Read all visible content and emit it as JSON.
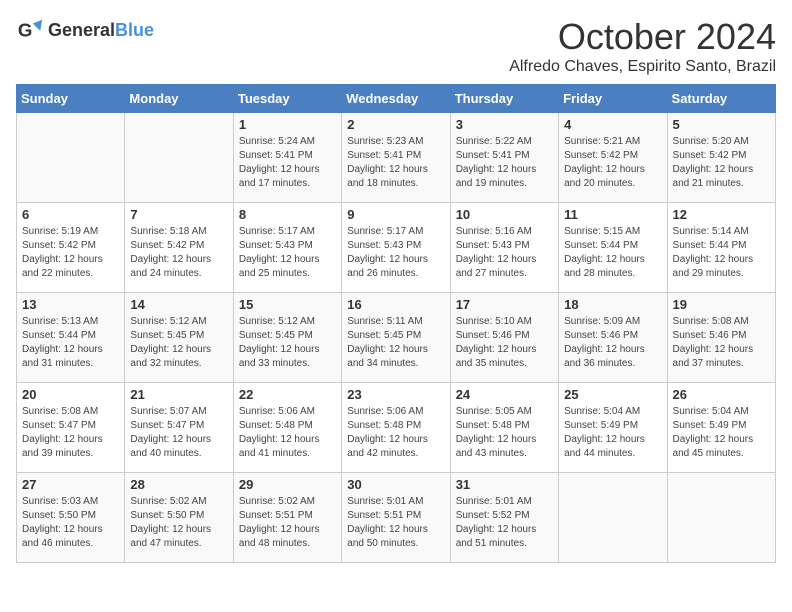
{
  "logo": {
    "general": "General",
    "blue": "Blue"
  },
  "header": {
    "month": "October 2024",
    "location": "Alfredo Chaves, Espirito Santo, Brazil"
  },
  "days_of_week": [
    "Sunday",
    "Monday",
    "Tuesday",
    "Wednesday",
    "Thursday",
    "Friday",
    "Saturday"
  ],
  "weeks": [
    [
      {
        "day": "",
        "content": ""
      },
      {
        "day": "",
        "content": ""
      },
      {
        "day": "1",
        "content": "Sunrise: 5:24 AM\nSunset: 5:41 PM\nDaylight: 12 hours and 17 minutes."
      },
      {
        "day": "2",
        "content": "Sunrise: 5:23 AM\nSunset: 5:41 PM\nDaylight: 12 hours and 18 minutes."
      },
      {
        "day": "3",
        "content": "Sunrise: 5:22 AM\nSunset: 5:41 PM\nDaylight: 12 hours and 19 minutes."
      },
      {
        "day": "4",
        "content": "Sunrise: 5:21 AM\nSunset: 5:42 PM\nDaylight: 12 hours and 20 minutes."
      },
      {
        "day": "5",
        "content": "Sunrise: 5:20 AM\nSunset: 5:42 PM\nDaylight: 12 hours and 21 minutes."
      }
    ],
    [
      {
        "day": "6",
        "content": "Sunrise: 5:19 AM\nSunset: 5:42 PM\nDaylight: 12 hours and 22 minutes."
      },
      {
        "day": "7",
        "content": "Sunrise: 5:18 AM\nSunset: 5:42 PM\nDaylight: 12 hours and 24 minutes."
      },
      {
        "day": "8",
        "content": "Sunrise: 5:17 AM\nSunset: 5:43 PM\nDaylight: 12 hours and 25 minutes."
      },
      {
        "day": "9",
        "content": "Sunrise: 5:17 AM\nSunset: 5:43 PM\nDaylight: 12 hours and 26 minutes."
      },
      {
        "day": "10",
        "content": "Sunrise: 5:16 AM\nSunset: 5:43 PM\nDaylight: 12 hours and 27 minutes."
      },
      {
        "day": "11",
        "content": "Sunrise: 5:15 AM\nSunset: 5:44 PM\nDaylight: 12 hours and 28 minutes."
      },
      {
        "day": "12",
        "content": "Sunrise: 5:14 AM\nSunset: 5:44 PM\nDaylight: 12 hours and 29 minutes."
      }
    ],
    [
      {
        "day": "13",
        "content": "Sunrise: 5:13 AM\nSunset: 5:44 PM\nDaylight: 12 hours and 31 minutes."
      },
      {
        "day": "14",
        "content": "Sunrise: 5:12 AM\nSunset: 5:45 PM\nDaylight: 12 hours and 32 minutes."
      },
      {
        "day": "15",
        "content": "Sunrise: 5:12 AM\nSunset: 5:45 PM\nDaylight: 12 hours and 33 minutes."
      },
      {
        "day": "16",
        "content": "Sunrise: 5:11 AM\nSunset: 5:45 PM\nDaylight: 12 hours and 34 minutes."
      },
      {
        "day": "17",
        "content": "Sunrise: 5:10 AM\nSunset: 5:46 PM\nDaylight: 12 hours and 35 minutes."
      },
      {
        "day": "18",
        "content": "Sunrise: 5:09 AM\nSunset: 5:46 PM\nDaylight: 12 hours and 36 minutes."
      },
      {
        "day": "19",
        "content": "Sunrise: 5:08 AM\nSunset: 5:46 PM\nDaylight: 12 hours and 37 minutes."
      }
    ],
    [
      {
        "day": "20",
        "content": "Sunrise: 5:08 AM\nSunset: 5:47 PM\nDaylight: 12 hours and 39 minutes."
      },
      {
        "day": "21",
        "content": "Sunrise: 5:07 AM\nSunset: 5:47 PM\nDaylight: 12 hours and 40 minutes."
      },
      {
        "day": "22",
        "content": "Sunrise: 5:06 AM\nSunset: 5:48 PM\nDaylight: 12 hours and 41 minutes."
      },
      {
        "day": "23",
        "content": "Sunrise: 5:06 AM\nSunset: 5:48 PM\nDaylight: 12 hours and 42 minutes."
      },
      {
        "day": "24",
        "content": "Sunrise: 5:05 AM\nSunset: 5:48 PM\nDaylight: 12 hours and 43 minutes."
      },
      {
        "day": "25",
        "content": "Sunrise: 5:04 AM\nSunset: 5:49 PM\nDaylight: 12 hours and 44 minutes."
      },
      {
        "day": "26",
        "content": "Sunrise: 5:04 AM\nSunset: 5:49 PM\nDaylight: 12 hours and 45 minutes."
      }
    ],
    [
      {
        "day": "27",
        "content": "Sunrise: 5:03 AM\nSunset: 5:50 PM\nDaylight: 12 hours and 46 minutes."
      },
      {
        "day": "28",
        "content": "Sunrise: 5:02 AM\nSunset: 5:50 PM\nDaylight: 12 hours and 47 minutes."
      },
      {
        "day": "29",
        "content": "Sunrise: 5:02 AM\nSunset: 5:51 PM\nDaylight: 12 hours and 48 minutes."
      },
      {
        "day": "30",
        "content": "Sunrise: 5:01 AM\nSunset: 5:51 PM\nDaylight: 12 hours and 50 minutes."
      },
      {
        "day": "31",
        "content": "Sunrise: 5:01 AM\nSunset: 5:52 PM\nDaylight: 12 hours and 51 minutes."
      },
      {
        "day": "",
        "content": ""
      },
      {
        "day": "",
        "content": ""
      }
    ]
  ]
}
